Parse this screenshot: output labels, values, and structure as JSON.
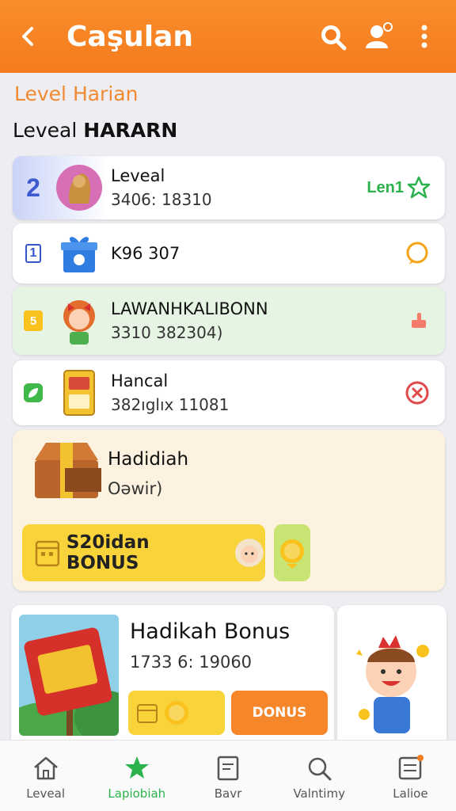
{
  "appbar": {
    "title": "Caşulan"
  },
  "subhead": "Level Harian",
  "section": {
    "prefix": "Leveal ",
    "bold": "HARARN"
  },
  "rows": [
    {
      "num": "2",
      "title": "Leveal",
      "subtitle": "3406: 18310",
      "status": "Len1",
      "bg": "#ffffff"
    },
    {
      "num": "1",
      "title": "K96 307",
      "subtitle": "",
      "status": "",
      "bg": "#ffffff"
    },
    {
      "num": "5",
      "title": "LAWANHKALIBONN",
      "subtitle": "3310 382304)",
      "status": "",
      "bg": "#e6f5e3"
    },
    {
      "num": "",
      "title": "Hancal",
      "subtitle": "382ıglıx 11081",
      "status": "",
      "bg": "#ffffff"
    }
  ],
  "bonus": {
    "title": "Hadidiah",
    "subtitle": "Oəwir)",
    "button_label": "S20idan BONUS"
  },
  "promo": {
    "title": "Hadikah Bonus",
    "subtitle": "1733 6: 19060",
    "orange_label": "DONUS"
  },
  "nav": [
    {
      "label": "Leveal",
      "icon": "home-icon"
    },
    {
      "label": "Lapiobiah",
      "icon": "star-icon"
    },
    {
      "label": "Bavr",
      "icon": "document-icon"
    },
    {
      "label": "Valntimy",
      "icon": "search-icon"
    },
    {
      "label": "Lalioe",
      "icon": "list-icon"
    }
  ],
  "colors": {
    "accent": "#f47b1e",
    "green": "#2bb24c",
    "yellow": "#f9d33a"
  }
}
